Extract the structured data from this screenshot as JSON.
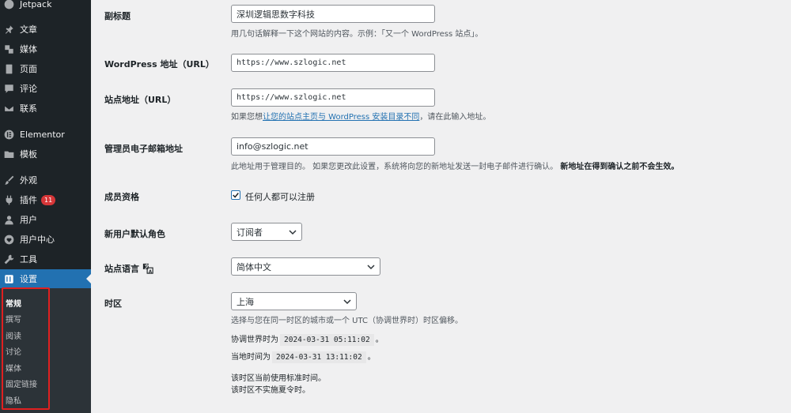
{
  "sidebar": {
    "items": [
      {
        "label": "Jetpack",
        "icon": "jetpack-icon"
      },
      {
        "label": "文章",
        "icon": "pin-icon"
      },
      {
        "label": "媒体",
        "icon": "media-icon"
      },
      {
        "label": "页面",
        "icon": "page-icon"
      },
      {
        "label": "评论",
        "icon": "comment-icon"
      },
      {
        "label": "联系",
        "icon": "mail-icon"
      },
      {
        "label": "Elementor",
        "icon": "elementor-icon"
      },
      {
        "label": "模板",
        "icon": "folder-icon"
      },
      {
        "label": "外观",
        "icon": "brush-icon"
      },
      {
        "label": "插件",
        "icon": "plugin-icon",
        "badge": "11"
      },
      {
        "label": "用户",
        "icon": "user-icon"
      },
      {
        "label": "用户中心",
        "icon": "heart-icon"
      },
      {
        "label": "工具",
        "icon": "wrench-icon"
      },
      {
        "label": "设置",
        "icon": "settings-icon"
      }
    ],
    "submenu": [
      "常规",
      "撰写",
      "阅读",
      "讨论",
      "媒体",
      "固定链接",
      "隐私"
    ]
  },
  "form": {
    "tagline": {
      "label": "副标题",
      "value": "深圳逻辑思数字科技",
      "desc": "用几句话解释一下这个网站的内容。示例：「又一个 WordPress 站点」。"
    },
    "wp_url": {
      "label": "WordPress 地址（URL）",
      "value": "https://www.szlogic.net"
    },
    "site_url": {
      "label": "站点地址（URL）",
      "value": "https://www.szlogic.net",
      "desc_before": "如果您想",
      "desc_link": "让您的站点主页与 WordPress 安装目录不同",
      "desc_after": "，请在此输入地址。"
    },
    "admin_email": {
      "label": "管理员电子邮箱地址",
      "value": "info@szlogic.net",
      "desc": "此地址用于管理目的。 如果您更改此设置，系统将向您的新地址发送一封电子邮件进行确认。",
      "desc_bold": "新地址在得到确认之前不会生效。"
    },
    "membership": {
      "label": "成员资格",
      "checkbox_label": "任何人都可以注册",
      "checked": true
    },
    "default_role": {
      "label": "新用户默认角色",
      "value": "订阅者"
    },
    "language": {
      "label": "站点语言",
      "value": "简体中文"
    },
    "timezone": {
      "label": "时区",
      "value": "上海",
      "desc": "选择与您在同一时区的城市或一个 UTC（协调世界时）时区偏移。",
      "utc_prefix": "协调世界时为",
      "utc_time": "2024-03-31 05:11:02",
      "local_prefix": "当地时间为",
      "local_time": "2024-03-31 13:11:02",
      "period": "。",
      "note1": "该时区当前使用标准时间。",
      "note2": "该时区不实施夏令时。"
    }
  }
}
